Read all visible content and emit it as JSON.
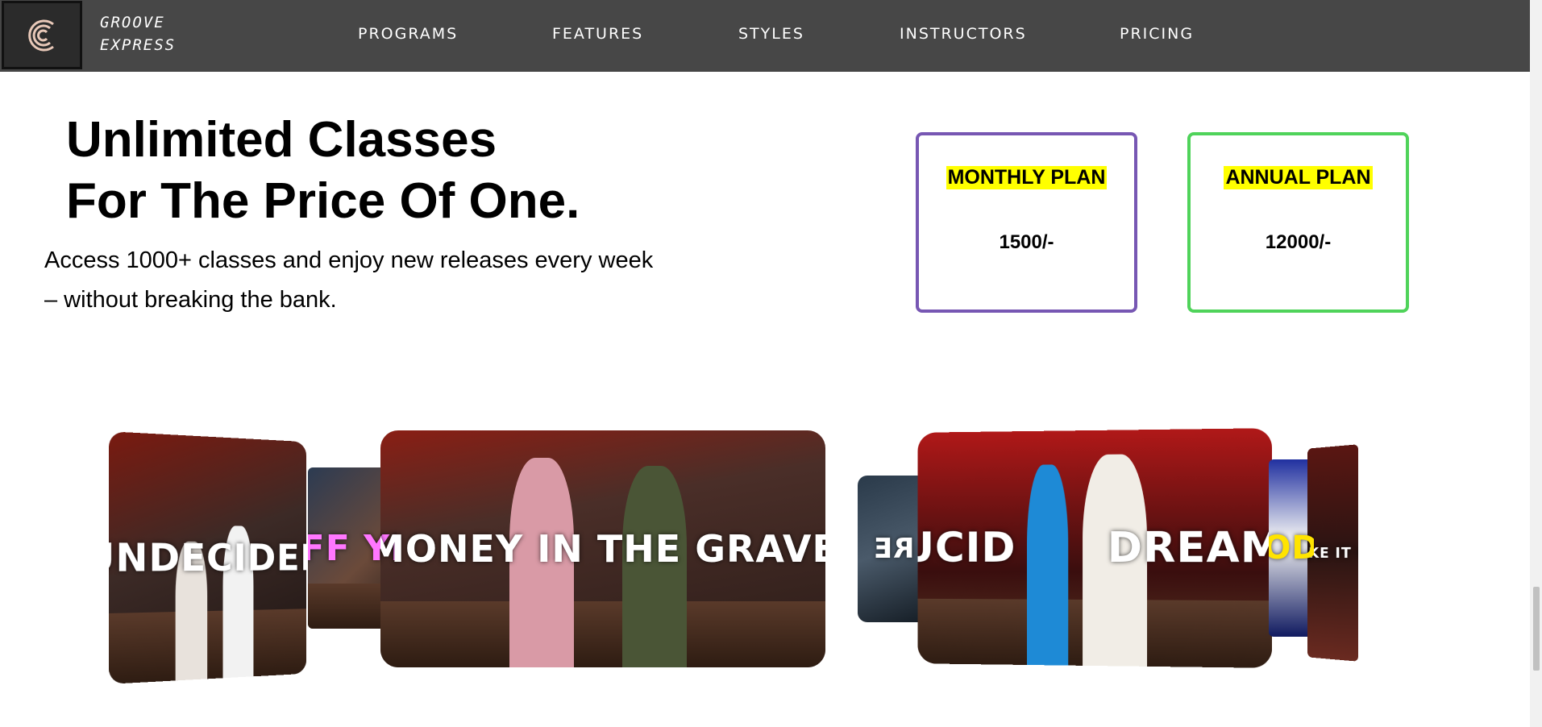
{
  "header": {
    "brand_line1": "GROOVE",
    "brand_line2": "EXPRESS",
    "logo_icon": "brand-logo-icon",
    "nav": [
      {
        "label": "PROGRAMS"
      },
      {
        "label": "FEATURES"
      },
      {
        "label": "STYLES"
      },
      {
        "label": "INSTRUCTORS"
      },
      {
        "label": "PRICING"
      }
    ]
  },
  "hero": {
    "title_line1": "Unlimited Classes",
    "title_line2": "For The Price Of One.",
    "description": "Access 1000+ classes and enjoy new releases every week – without breaking the bank."
  },
  "plans": [
    {
      "name": "MONTHLY PLAN",
      "price": "1500/-",
      "border_color": "#7757b3"
    },
    {
      "name": "ANNUAL PLAN",
      "price": "12000/-",
      "border_color": "#4fd35a"
    }
  ],
  "carousel": {
    "videos": [
      {
        "title": "UNDECIDED"
      },
      {
        "title": "FF YI"
      },
      {
        "title": "MONEY IN THE GRAVE"
      },
      {
        "title": "RE"
      },
      {
        "title": "LUCID      DREAMS"
      },
      {
        "title": "OD"
      },
      {
        "title": "RAKE IT UP"
      }
    ]
  },
  "colors": {
    "navbar": "#474747",
    "highlight": "#ffff00",
    "monthly_border": "#7757b3",
    "annual_border": "#4fd35a"
  }
}
